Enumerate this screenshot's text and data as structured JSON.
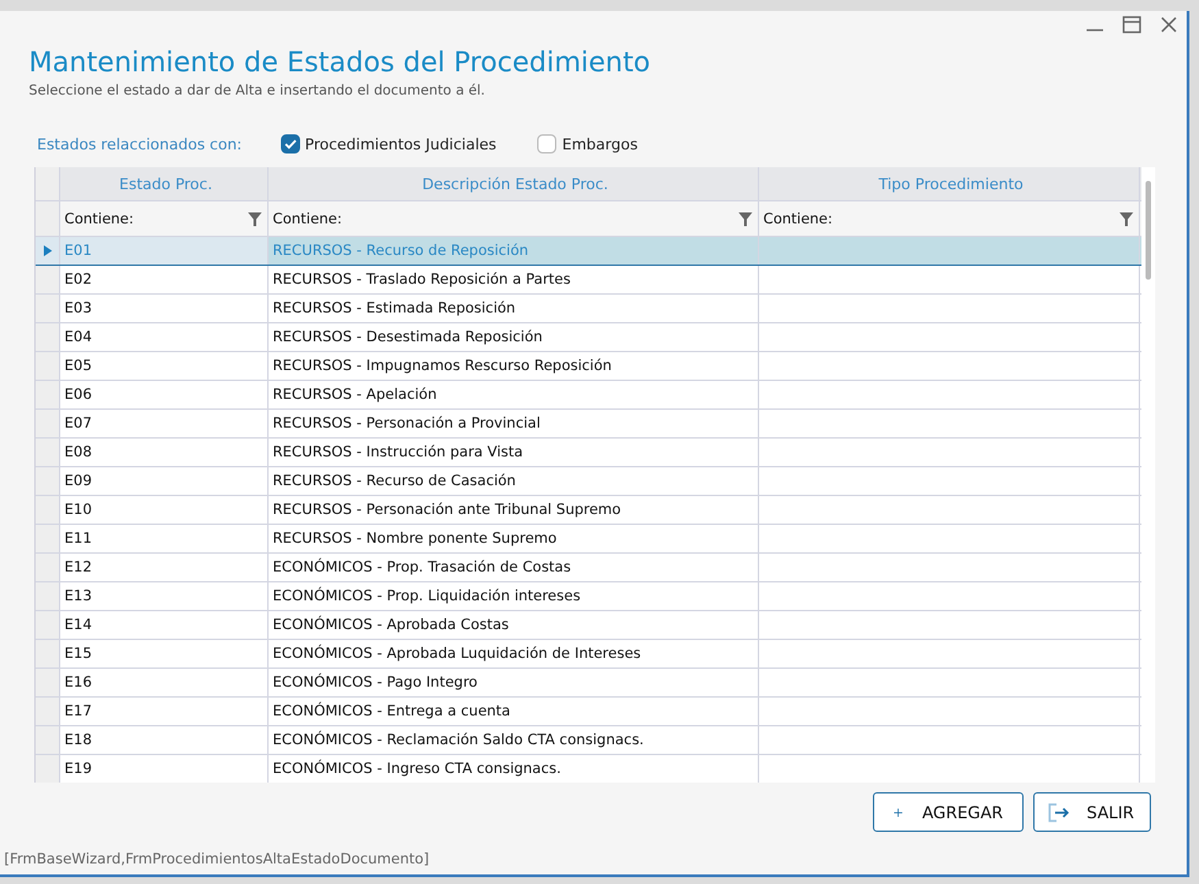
{
  "window": {
    "title": "Mantenimiento de Estados del Procedimiento",
    "subtitle": "Seleccione el estado a dar de Alta e insertando el documento a él."
  },
  "filter": {
    "label": "Estados relaccionados con:",
    "options": [
      {
        "label": "Procedimientos Judiciales",
        "checked": true
      },
      {
        "label": "Embargos",
        "checked": false
      }
    ]
  },
  "table": {
    "columns": [
      {
        "label": "Estado Proc.",
        "filter": "Contiene:"
      },
      {
        "label": "Descripción Estado Proc.",
        "filter": "Contiene:"
      },
      {
        "label": "Tipo Procedimiento",
        "filter": "Contiene:"
      }
    ],
    "rows": [
      {
        "cells": [
          "E01",
          "RECURSOS - Recurso de Reposición",
          ""
        ],
        "selected": true
      },
      {
        "cells": [
          "E02",
          "RECURSOS - Traslado Reposición a Partes",
          ""
        ],
        "selected": false
      },
      {
        "cells": [
          "E03",
          "RECURSOS - Estimada Reposición",
          ""
        ],
        "selected": false
      },
      {
        "cells": [
          "E04",
          "RECURSOS - Desestimada Reposición",
          ""
        ],
        "selected": false
      },
      {
        "cells": [
          "E05",
          "RECURSOS - Impugnamos Rescurso Reposición",
          ""
        ],
        "selected": false
      },
      {
        "cells": [
          "E06",
          "RECURSOS - Apelación",
          ""
        ],
        "selected": false
      },
      {
        "cells": [
          "E07",
          "RECURSOS - Personación a Provincial",
          ""
        ],
        "selected": false
      },
      {
        "cells": [
          "E08",
          "RECURSOS - Instrucción para Vista",
          ""
        ],
        "selected": false
      },
      {
        "cells": [
          "E09",
          "RECURSOS - Recurso de Casación",
          ""
        ],
        "selected": false
      },
      {
        "cells": [
          "E10",
          "RECURSOS - Personación ante Tribunal Supremo",
          ""
        ],
        "selected": false
      },
      {
        "cells": [
          "E11",
          "RECURSOS - Nombre ponente Supremo",
          ""
        ],
        "selected": false
      },
      {
        "cells": [
          "E12",
          "ECONÓMICOS - Prop. Trasación de Costas",
          ""
        ],
        "selected": false
      },
      {
        "cells": [
          "E13",
          "ECONÓMICOS - Prop. Liquidación intereses",
          ""
        ],
        "selected": false
      },
      {
        "cells": [
          "E14",
          "ECONÓMICOS - Aprobada Costas",
          ""
        ],
        "selected": false
      },
      {
        "cells": [
          "E15",
          "ECONÓMICOS - Aprobada Luquidación de Intereses",
          ""
        ],
        "selected": false
      },
      {
        "cells": [
          "E16",
          "ECONÓMICOS - Pago Integro",
          ""
        ],
        "selected": false
      },
      {
        "cells": [
          "E17",
          "ECONÓMICOS - Entrega a cuenta",
          ""
        ],
        "selected": false
      },
      {
        "cells": [
          "E18",
          "ECONÓMICOS - Reclamación Saldo CTA consignacs.",
          ""
        ],
        "selected": false
      },
      {
        "cells": [
          "E19",
          "ECONÓMICOS - Ingreso CTA consignacs.",
          ""
        ],
        "selected": false
      }
    ]
  },
  "buttons": [
    {
      "label": "AGREGAR",
      "kind": "add"
    },
    {
      "label": "SALIR",
      "kind": "exit"
    }
  ],
  "status_bar": "[FrmBaseWizard,FrmProcedimientosAltaEstadoDocumento]"
}
